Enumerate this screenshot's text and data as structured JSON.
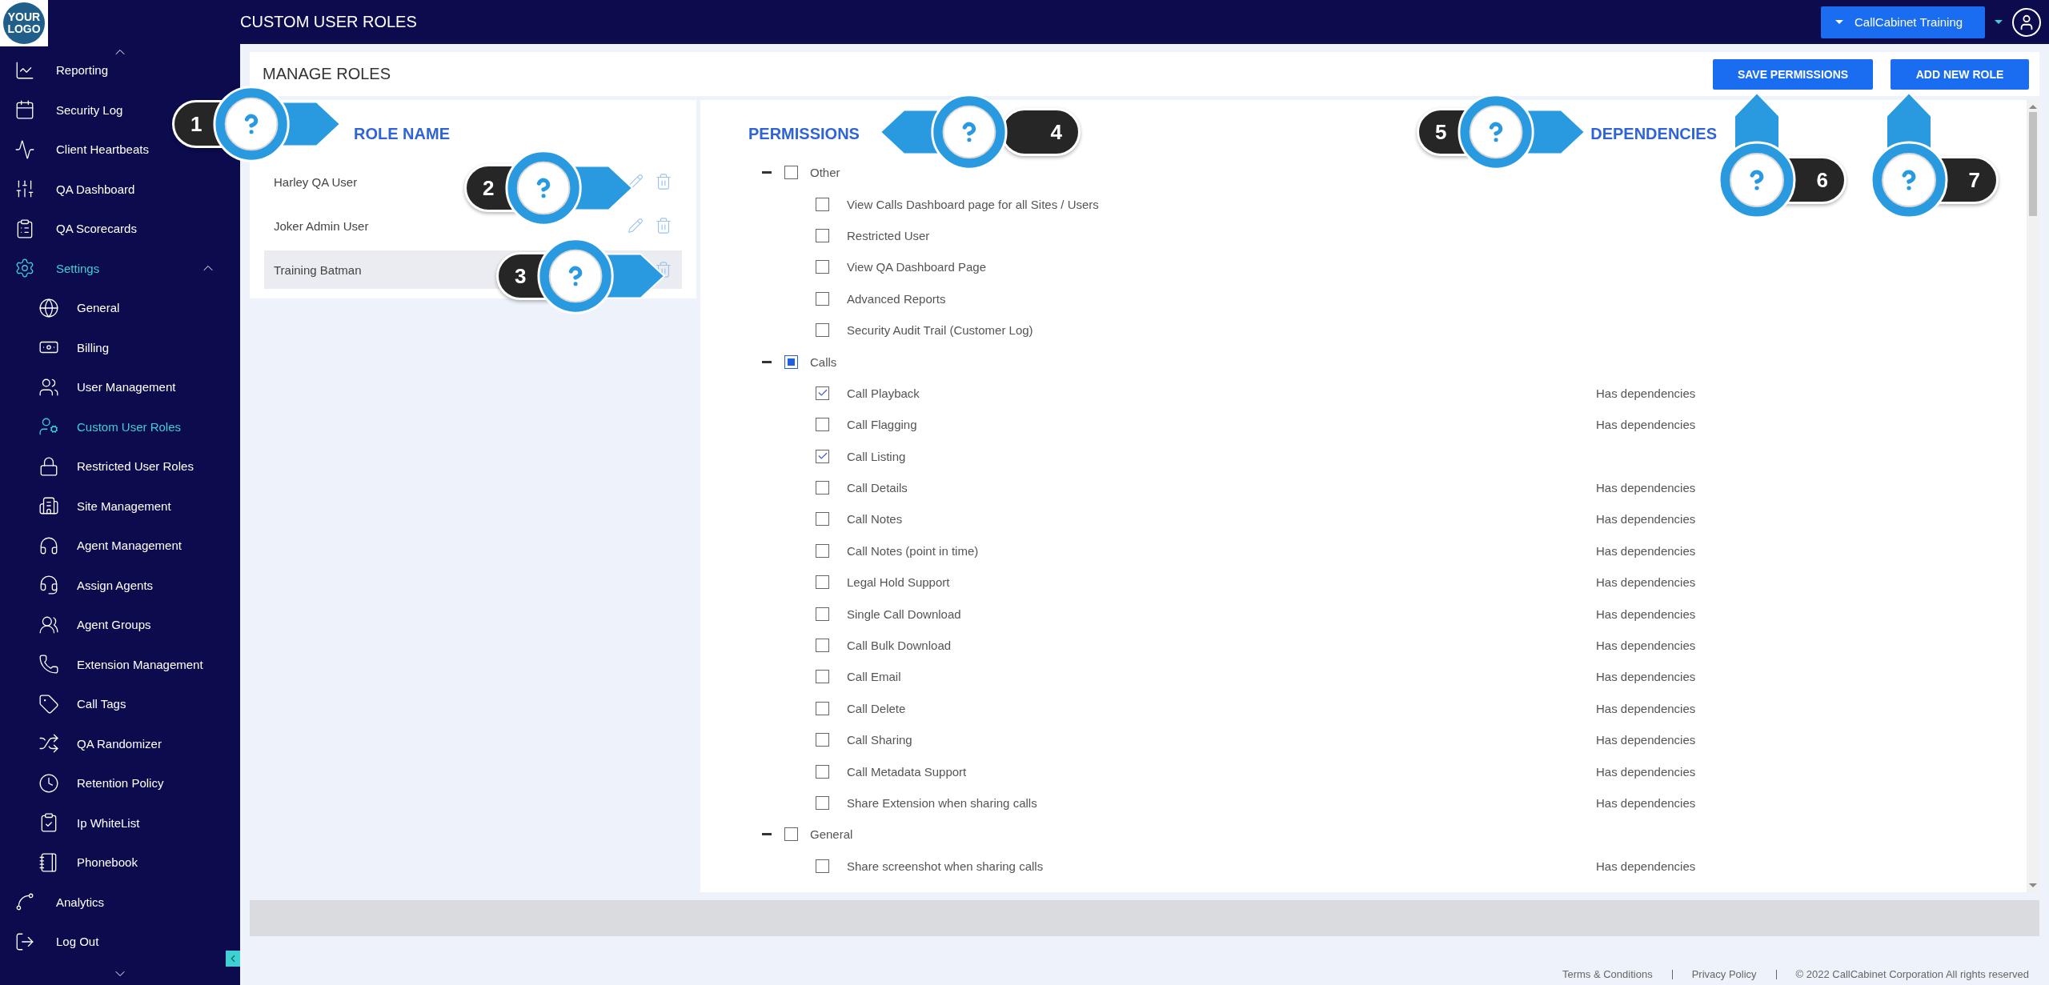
{
  "header": {
    "logo": "YOUR LOGO",
    "title": "CUSTOM USER ROLES",
    "account": "CallCabinet Training"
  },
  "sidebar": {
    "items": [
      {
        "label": "Reporting",
        "selected": false
      },
      {
        "label": "Security Log",
        "selected": false
      },
      {
        "label": "Client Heartbeats",
        "selected": false
      },
      {
        "label": "QA Dashboard",
        "selected": false
      },
      {
        "label": "QA Scorecards",
        "selected": false
      },
      {
        "label": "Settings",
        "selected": true,
        "expanded": true,
        "children": [
          {
            "label": "General",
            "selected": false
          },
          {
            "label": "Billing",
            "selected": false
          },
          {
            "label": "User Management",
            "selected": false
          },
          {
            "label": "Custom User Roles",
            "selected": true
          },
          {
            "label": "Restricted User Roles",
            "selected": false
          },
          {
            "label": "Site Management",
            "selected": false
          },
          {
            "label": "Agent Management",
            "selected": false
          },
          {
            "label": "Assign Agents",
            "selected": false
          },
          {
            "label": "Agent Groups",
            "selected": false
          },
          {
            "label": "Extension Management",
            "selected": false
          },
          {
            "label": "Call Tags",
            "selected": false
          },
          {
            "label": "QA Randomizer",
            "selected": false
          },
          {
            "label": "Retention Policy",
            "selected": false
          },
          {
            "label": "Ip WhiteList",
            "selected": false
          },
          {
            "label": "Phonebook",
            "selected": false
          }
        ]
      },
      {
        "label": "Analytics",
        "selected": false
      },
      {
        "label": "Log Out",
        "selected": false
      }
    ]
  },
  "toolbar": {
    "title": "MANAGE ROLES",
    "buttons": [
      "SAVE PERMISSIONS",
      "ADD NEW ROLE"
    ]
  },
  "roles": {
    "heading": "ROLE NAME",
    "items": [
      {
        "name": "Harley QA User",
        "selected": false
      },
      {
        "name": "Joker Admin User",
        "selected": false
      },
      {
        "name": "Training Batman",
        "selected": true
      }
    ]
  },
  "permissions": {
    "heading": "PERMISSIONS",
    "dependencies_heading": "DEPENDENCIES",
    "groups": [
      {
        "label": "Other",
        "expanded": true,
        "checked": false,
        "partial": false,
        "children": [
          {
            "label": "View Calls Dashboard page for all Sites / Users",
            "checked": false
          },
          {
            "label": "Restricted User",
            "checked": false
          },
          {
            "label": "View QA Dashboard Page",
            "checked": false
          },
          {
            "label": "Advanced Reports",
            "checked": false
          },
          {
            "label": "Security Audit Trail (Customer Log)",
            "checked": false
          }
        ]
      },
      {
        "label": "Calls",
        "expanded": true,
        "checked": false,
        "partial": true,
        "children": [
          {
            "label": "Call Playback",
            "checked": true,
            "note": "Has dependencies"
          },
          {
            "label": "Call Flagging",
            "checked": false,
            "note": "Has dependencies"
          },
          {
            "label": "Call Listing",
            "checked": true
          },
          {
            "label": "Call Details",
            "checked": false,
            "note": "Has dependencies"
          },
          {
            "label": "Call Notes",
            "checked": false,
            "note": "Has dependencies"
          },
          {
            "label": "Call Notes (point in time)",
            "checked": false,
            "note": "Has dependencies"
          },
          {
            "label": "Legal Hold Support",
            "checked": false,
            "note": "Has dependencies"
          },
          {
            "label": "Single Call Download",
            "checked": false,
            "note": "Has dependencies"
          },
          {
            "label": "Call Bulk Download",
            "checked": false,
            "note": "Has dependencies"
          },
          {
            "label": "Call Email",
            "checked": false,
            "note": "Has dependencies"
          },
          {
            "label": "Call Delete",
            "checked": false,
            "note": "Has dependencies"
          },
          {
            "label": "Call Sharing",
            "checked": false,
            "note": "Has dependencies"
          },
          {
            "label": "Call Metadata Support",
            "checked": false,
            "note": "Has dependencies"
          },
          {
            "label": "Share Extension when sharing calls",
            "checked": false,
            "note": "Has dependencies"
          }
        ]
      },
      {
        "label": "General",
        "expanded": true,
        "checked": false,
        "partial": false,
        "children": [
          {
            "label": "Share screenshot when sharing calls",
            "checked": false,
            "note": "Has dependencies"
          }
        ]
      }
    ]
  },
  "footer": {
    "links": [
      "Terms & Conditions",
      "Privacy Policy"
    ],
    "copyright": "© 2022 CallCabinet Corporation All rights reserved"
  },
  "callouts": [
    {
      "number": "1",
      "kind": "right"
    },
    {
      "number": "2",
      "kind": "right"
    },
    {
      "number": "3",
      "kind": "right"
    },
    {
      "number": "4",
      "kind": "left"
    },
    {
      "number": "5",
      "kind": "right"
    },
    {
      "number": "6",
      "kind": "up"
    },
    {
      "number": "7",
      "kind": "up"
    }
  ]
}
